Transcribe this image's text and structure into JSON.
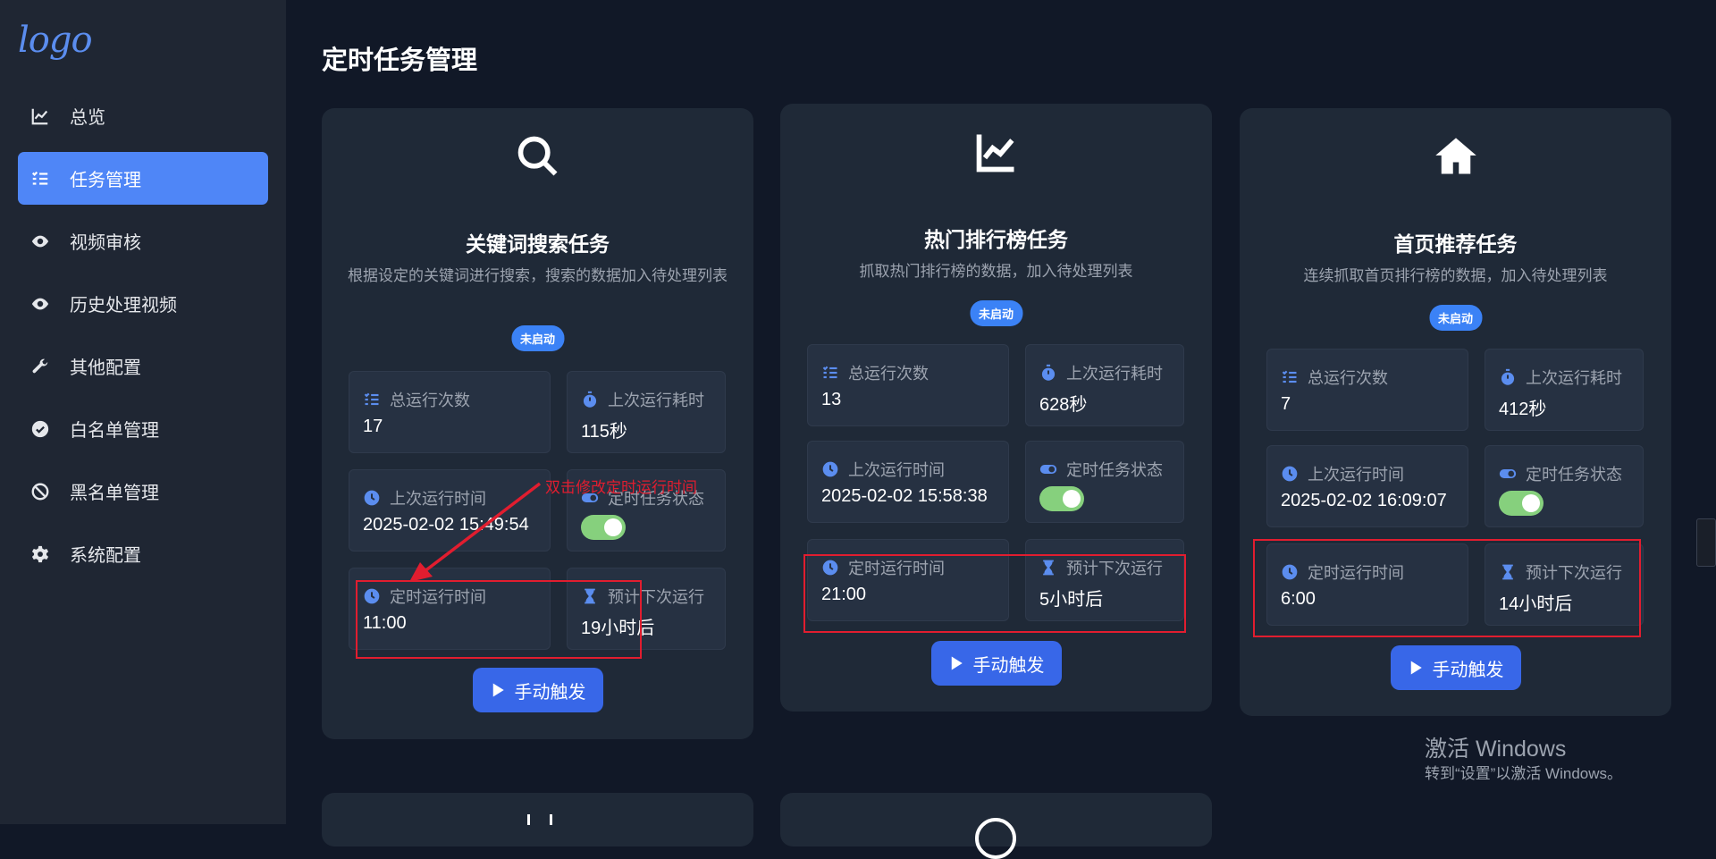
{
  "app": {
    "logo_text": "logo"
  },
  "sidebar": {
    "items": [
      {
        "label": "总览",
        "icon": "chart-line-icon",
        "active": false
      },
      {
        "label": "任务管理",
        "icon": "list-check-icon",
        "active": true
      },
      {
        "label": "视频审核",
        "icon": "eye-icon",
        "active": false
      },
      {
        "label": "历史处理视频",
        "icon": "eye-icon",
        "active": false
      },
      {
        "label": "其他配置",
        "icon": "wrench-icon",
        "active": false
      },
      {
        "label": "白名单管理",
        "icon": "check-circle-icon",
        "active": false
      },
      {
        "label": "黑名单管理",
        "icon": "ban-icon",
        "active": false
      },
      {
        "label": "系统配置",
        "icon": "gear-icon",
        "active": false
      }
    ]
  },
  "page": {
    "title": "定时任务管理"
  },
  "labels": {
    "total_runs": "总运行次数",
    "last_duration": "上次运行耗时",
    "last_run_time": "上次运行时间",
    "schedule_status": "定时任务状态",
    "schedule_time": "定时运行时间",
    "next_run": "预计下次运行",
    "trigger": "手动触发",
    "status_badge": "未启动"
  },
  "cards": [
    {
      "icon": "search-icon",
      "title": "关键词搜索任务",
      "desc": "根据设定的关键词进行搜索，搜索的数据加入待处理列表",
      "total_runs": "17",
      "last_duration": "115秒",
      "last_run_time": "2025-02-02 15:49:54",
      "schedule_enabled": true,
      "schedule_time": "11:00",
      "next_run": "19小时后"
    },
    {
      "icon": "chart-line-icon",
      "title": "热门排行榜任务",
      "desc": "抓取热门排行榜的数据，加入待处理列表",
      "total_runs": "13",
      "last_duration": "628秒",
      "last_run_time": "2025-02-02 15:58:38",
      "schedule_enabled": true,
      "schedule_time": "21:00",
      "next_run": "5小时后"
    },
    {
      "icon": "home-icon",
      "title": "首页推荐任务",
      "desc": "连续抓取首页排行榜的数据，加入待处理列表",
      "total_runs": "7",
      "last_duration": "412秒",
      "last_run_time": "2025-02-02 16:09:07",
      "schedule_enabled": true,
      "schedule_time": "6:00",
      "next_run": "14小时后"
    }
  ],
  "annotation": {
    "text": "双击修改定时运行时间"
  },
  "watermark": {
    "line1": "激活 Windows",
    "line2": "转到“设置”以激活 Windows。"
  },
  "colors": {
    "accent": "#4f86f7",
    "toggle_on": "#86d07d",
    "annotation": "#e11d2f",
    "badge": "#3b82f6"
  }
}
